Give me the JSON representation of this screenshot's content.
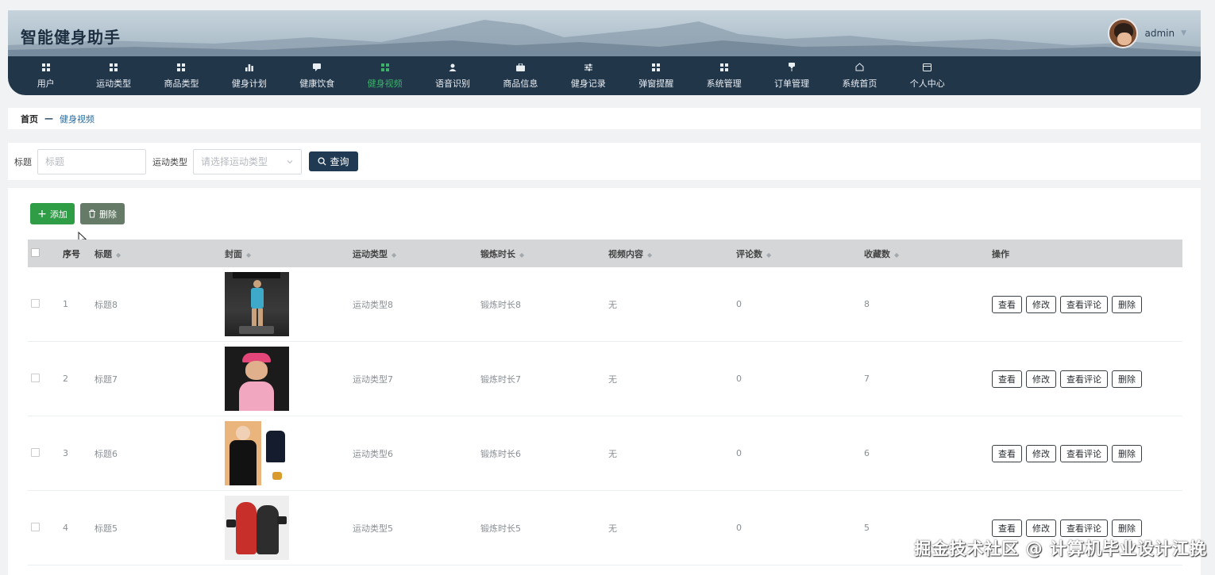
{
  "app": {
    "title": "智能健身助手",
    "username": "admin"
  },
  "nav": [
    {
      "label": "用户",
      "icon": "grid-icon"
    },
    {
      "label": "运动类型",
      "icon": "grid-icon"
    },
    {
      "label": "商品类型",
      "icon": "grid-icon"
    },
    {
      "label": "健身计划",
      "icon": "bar-chart-icon"
    },
    {
      "label": "健康饮食",
      "icon": "chat-icon"
    },
    {
      "label": "健身视频",
      "icon": "grid-icon",
      "active": true
    },
    {
      "label": "语音识别",
      "icon": "user-icon"
    },
    {
      "label": "商品信息",
      "icon": "briefcase-icon"
    },
    {
      "label": "健身记录",
      "icon": "sliders-icon"
    },
    {
      "label": "弹窗提醒",
      "icon": "grid-icon"
    },
    {
      "label": "系统管理",
      "icon": "grid-icon"
    },
    {
      "label": "订单管理",
      "icon": "pin-icon"
    },
    {
      "label": "系统首页",
      "icon": "home-icon"
    },
    {
      "label": "个人中心",
      "icon": "card-icon"
    }
  ],
  "breadcrumb": {
    "home": "首页",
    "separator": "—",
    "current": "健身视频"
  },
  "search": {
    "title_label": "标题",
    "title_placeholder": "标题",
    "type_label": "运动类型",
    "type_placeholder": "请选择运动类型",
    "search_button": "查询"
  },
  "actions": {
    "add": "添加",
    "delete": "删除"
  },
  "table": {
    "headers": {
      "no": "序号",
      "title": "标题",
      "cover": "封面",
      "type": "运动类型",
      "duration": "锻炼时长",
      "video": "视频内容",
      "comments": "评论数",
      "favorites": "收藏数",
      "ops": "操作"
    },
    "row_buttons": {
      "view": "查看",
      "edit": "修改",
      "view_comments": "查看评论",
      "delete": "删除"
    },
    "rows": [
      {
        "no": "1",
        "title": "标题8",
        "type": "运动类型8",
        "duration": "锻炼时长8",
        "video": "无",
        "comments": "0",
        "favorites": "8"
      },
      {
        "no": "2",
        "title": "标题7",
        "type": "运动类型7",
        "duration": "锻炼时长7",
        "video": "无",
        "comments": "0",
        "favorites": "7"
      },
      {
        "no": "3",
        "title": "标题6",
        "type": "运动类型6",
        "duration": "锻炼时长6",
        "video": "无",
        "comments": "0",
        "favorites": "6"
      },
      {
        "no": "4",
        "title": "标题5",
        "type": "运动类型5",
        "duration": "锻炼时长5",
        "video": "无",
        "comments": "0",
        "favorites": "5"
      }
    ]
  },
  "watermark": "掘金技术社区 @ 计算机毕业设计江挽",
  "colors": {
    "nav_bg": "#22364a",
    "active": "#3bb16a",
    "add": "#2e9d46",
    "delete": "#667a68",
    "search_btn": "#1f3a52"
  }
}
